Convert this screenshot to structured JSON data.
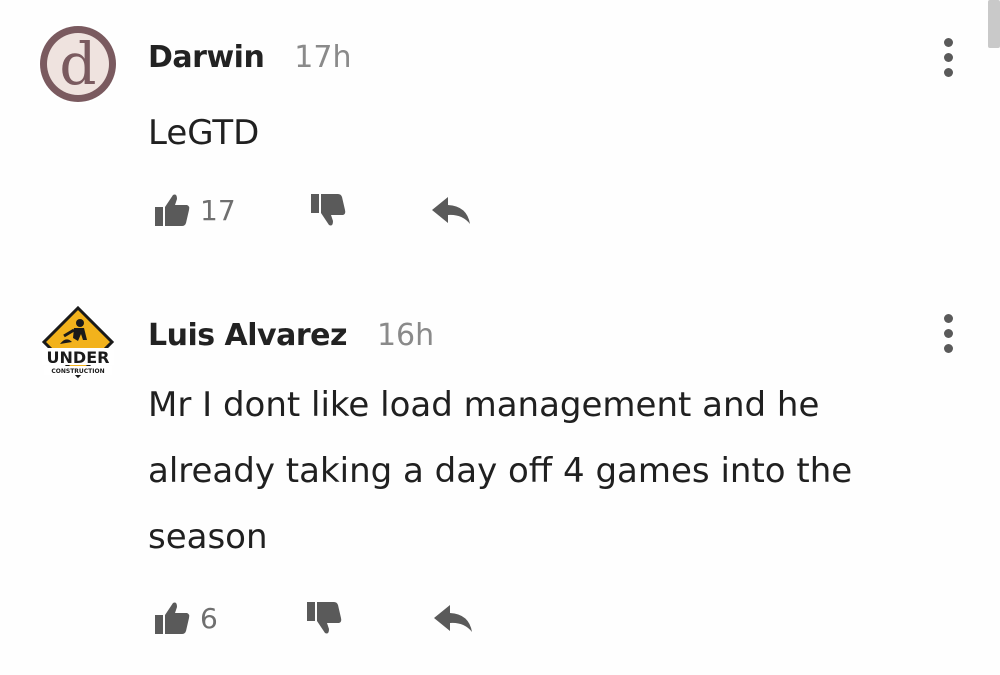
{
  "comments": [
    {
      "avatar_letter": "d",
      "username": "Darwin",
      "timestamp": "17h",
      "text": "LeGTD",
      "likes": "17",
      "icons": {
        "menu": "more-vertical-icon",
        "like": "thumbs-up-icon",
        "dislike": "thumbs-down-icon",
        "reply": "reply-arrow-icon"
      }
    },
    {
      "avatar_text_top": "UNDER",
      "avatar_text_bottom": "CONSTRUCTION",
      "username": "Luis Alvarez",
      "timestamp": "16h",
      "text": "Mr I dont like load management and he already taking a day off 4 games into the season",
      "likes": "6",
      "icons": {
        "menu": "more-vertical-icon",
        "like": "thumbs-up-icon",
        "dislike": "thumbs-down-icon",
        "reply": "reply-arrow-icon"
      }
    }
  ],
  "colors": {
    "icon_gray": "#5a5a5a",
    "text_dark": "#202020",
    "timestamp_gray": "#8a8a8a",
    "avatar_d_bg": "#7a5a5f",
    "avatar_warning_yellow": "#f2b21c"
  }
}
